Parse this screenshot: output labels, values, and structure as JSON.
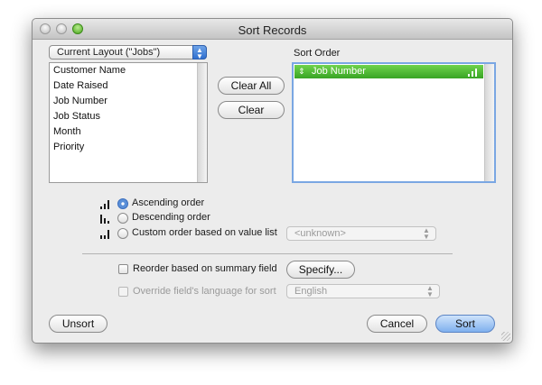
{
  "window": {
    "title": "Sort Records"
  },
  "source": {
    "popup_value": "Current Layout (\"Jobs\")",
    "fields": [
      "Customer Name",
      "Date Raised",
      "Job Number",
      "Job Status",
      "Month",
      "Priority"
    ]
  },
  "buttons": {
    "clear_all": "Clear All",
    "clear": "Clear",
    "specify": "Specify...",
    "unsort": "Unsort",
    "cancel": "Cancel",
    "sort": "Sort"
  },
  "sort_order": {
    "heading": "Sort Order",
    "items": [
      {
        "label": "Job Number",
        "marker": "⇕"
      }
    ]
  },
  "order_options": {
    "ascending": "Ascending order",
    "descending": "Descending order",
    "custom": "Custom order based on value list",
    "selected": "ascending",
    "value_list": "<unknown>"
  },
  "reorder": {
    "label": "Reorder based on summary field",
    "checked": false
  },
  "override": {
    "label": "Override field's language for sort",
    "checked": false,
    "enabled": false,
    "language": "English"
  },
  "colors": {
    "selection": "#38a424",
    "accent": "#3c6fbf"
  }
}
